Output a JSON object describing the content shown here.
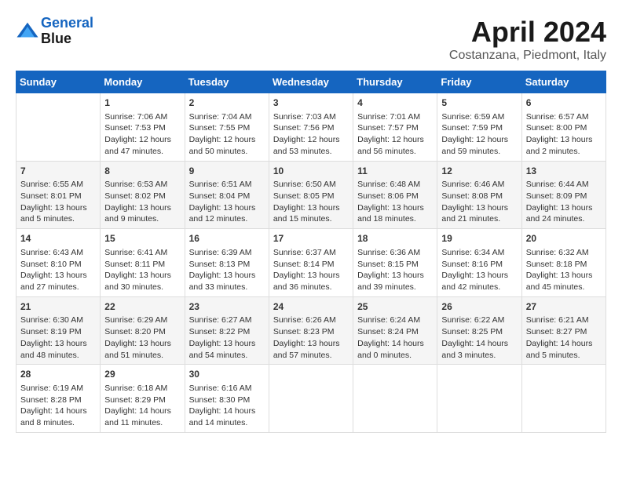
{
  "header": {
    "logo_line1": "General",
    "logo_line2": "Blue",
    "month": "April 2024",
    "location": "Costanzana, Piedmont, Italy"
  },
  "columns": [
    "Sunday",
    "Monday",
    "Tuesday",
    "Wednesday",
    "Thursday",
    "Friday",
    "Saturday"
  ],
  "weeks": [
    [
      {
        "day": "",
        "sunrise": "",
        "sunset": "",
        "daylight": ""
      },
      {
        "day": "1",
        "sunrise": "Sunrise: 7:06 AM",
        "sunset": "Sunset: 7:53 PM",
        "daylight": "Daylight: 12 hours and 47 minutes."
      },
      {
        "day": "2",
        "sunrise": "Sunrise: 7:04 AM",
        "sunset": "Sunset: 7:55 PM",
        "daylight": "Daylight: 12 hours and 50 minutes."
      },
      {
        "day": "3",
        "sunrise": "Sunrise: 7:03 AM",
        "sunset": "Sunset: 7:56 PM",
        "daylight": "Daylight: 12 hours and 53 minutes."
      },
      {
        "day": "4",
        "sunrise": "Sunrise: 7:01 AM",
        "sunset": "Sunset: 7:57 PM",
        "daylight": "Daylight: 12 hours and 56 minutes."
      },
      {
        "day": "5",
        "sunrise": "Sunrise: 6:59 AM",
        "sunset": "Sunset: 7:59 PM",
        "daylight": "Daylight: 12 hours and 59 minutes."
      },
      {
        "day": "6",
        "sunrise": "Sunrise: 6:57 AM",
        "sunset": "Sunset: 8:00 PM",
        "daylight": "Daylight: 13 hours and 2 minutes."
      }
    ],
    [
      {
        "day": "7",
        "sunrise": "Sunrise: 6:55 AM",
        "sunset": "Sunset: 8:01 PM",
        "daylight": "Daylight: 13 hours and 5 minutes."
      },
      {
        "day": "8",
        "sunrise": "Sunrise: 6:53 AM",
        "sunset": "Sunset: 8:02 PM",
        "daylight": "Daylight: 13 hours and 9 minutes."
      },
      {
        "day": "9",
        "sunrise": "Sunrise: 6:51 AM",
        "sunset": "Sunset: 8:04 PM",
        "daylight": "Daylight: 13 hours and 12 minutes."
      },
      {
        "day": "10",
        "sunrise": "Sunrise: 6:50 AM",
        "sunset": "Sunset: 8:05 PM",
        "daylight": "Daylight: 13 hours and 15 minutes."
      },
      {
        "day": "11",
        "sunrise": "Sunrise: 6:48 AM",
        "sunset": "Sunset: 8:06 PM",
        "daylight": "Daylight: 13 hours and 18 minutes."
      },
      {
        "day": "12",
        "sunrise": "Sunrise: 6:46 AM",
        "sunset": "Sunset: 8:08 PM",
        "daylight": "Daylight: 13 hours and 21 minutes."
      },
      {
        "day": "13",
        "sunrise": "Sunrise: 6:44 AM",
        "sunset": "Sunset: 8:09 PM",
        "daylight": "Daylight: 13 hours and 24 minutes."
      }
    ],
    [
      {
        "day": "14",
        "sunrise": "Sunrise: 6:43 AM",
        "sunset": "Sunset: 8:10 PM",
        "daylight": "Daylight: 13 hours and 27 minutes."
      },
      {
        "day": "15",
        "sunrise": "Sunrise: 6:41 AM",
        "sunset": "Sunset: 8:11 PM",
        "daylight": "Daylight: 13 hours and 30 minutes."
      },
      {
        "day": "16",
        "sunrise": "Sunrise: 6:39 AM",
        "sunset": "Sunset: 8:13 PM",
        "daylight": "Daylight: 13 hours and 33 minutes."
      },
      {
        "day": "17",
        "sunrise": "Sunrise: 6:37 AM",
        "sunset": "Sunset: 8:14 PM",
        "daylight": "Daylight: 13 hours and 36 minutes."
      },
      {
        "day": "18",
        "sunrise": "Sunrise: 6:36 AM",
        "sunset": "Sunset: 8:15 PM",
        "daylight": "Daylight: 13 hours and 39 minutes."
      },
      {
        "day": "19",
        "sunrise": "Sunrise: 6:34 AM",
        "sunset": "Sunset: 8:16 PM",
        "daylight": "Daylight: 13 hours and 42 minutes."
      },
      {
        "day": "20",
        "sunrise": "Sunrise: 6:32 AM",
        "sunset": "Sunset: 8:18 PM",
        "daylight": "Daylight: 13 hours and 45 minutes."
      }
    ],
    [
      {
        "day": "21",
        "sunrise": "Sunrise: 6:30 AM",
        "sunset": "Sunset: 8:19 PM",
        "daylight": "Daylight: 13 hours and 48 minutes."
      },
      {
        "day": "22",
        "sunrise": "Sunrise: 6:29 AM",
        "sunset": "Sunset: 8:20 PM",
        "daylight": "Daylight: 13 hours and 51 minutes."
      },
      {
        "day": "23",
        "sunrise": "Sunrise: 6:27 AM",
        "sunset": "Sunset: 8:22 PM",
        "daylight": "Daylight: 13 hours and 54 minutes."
      },
      {
        "day": "24",
        "sunrise": "Sunrise: 6:26 AM",
        "sunset": "Sunset: 8:23 PM",
        "daylight": "Daylight: 13 hours and 57 minutes."
      },
      {
        "day": "25",
        "sunrise": "Sunrise: 6:24 AM",
        "sunset": "Sunset: 8:24 PM",
        "daylight": "Daylight: 14 hours and 0 minutes."
      },
      {
        "day": "26",
        "sunrise": "Sunrise: 6:22 AM",
        "sunset": "Sunset: 8:25 PM",
        "daylight": "Daylight: 14 hours and 3 minutes."
      },
      {
        "day": "27",
        "sunrise": "Sunrise: 6:21 AM",
        "sunset": "Sunset: 8:27 PM",
        "daylight": "Daylight: 14 hours and 5 minutes."
      }
    ],
    [
      {
        "day": "28",
        "sunrise": "Sunrise: 6:19 AM",
        "sunset": "Sunset: 8:28 PM",
        "daylight": "Daylight: 14 hours and 8 minutes."
      },
      {
        "day": "29",
        "sunrise": "Sunrise: 6:18 AM",
        "sunset": "Sunset: 8:29 PM",
        "daylight": "Daylight: 14 hours and 11 minutes."
      },
      {
        "day": "30",
        "sunrise": "Sunrise: 6:16 AM",
        "sunset": "Sunset: 8:30 PM",
        "daylight": "Daylight: 14 hours and 14 minutes."
      },
      {
        "day": "",
        "sunrise": "",
        "sunset": "",
        "daylight": ""
      },
      {
        "day": "",
        "sunrise": "",
        "sunset": "",
        "daylight": ""
      },
      {
        "day": "",
        "sunrise": "",
        "sunset": "",
        "daylight": ""
      },
      {
        "day": "",
        "sunrise": "",
        "sunset": "",
        "daylight": ""
      }
    ]
  ]
}
